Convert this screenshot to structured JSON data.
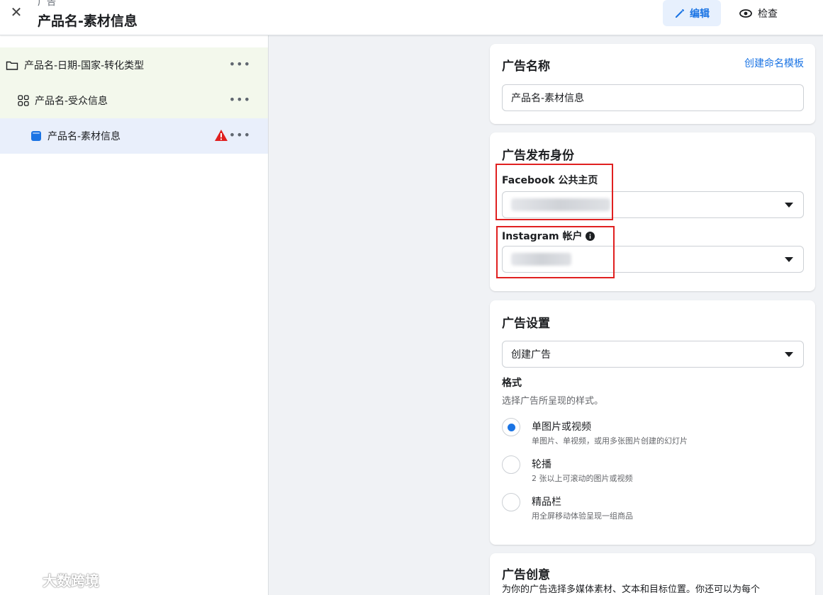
{
  "header": {
    "kicker": "广告",
    "title": "产品名-素材信息",
    "edit_label": "编辑",
    "review_label": "检查"
  },
  "tree": {
    "items": [
      {
        "label": "产品名-日期-国家-转化类型",
        "icon": "folder-icon"
      },
      {
        "label": "产品名-受众信息",
        "icon": "grid-icon"
      },
      {
        "label": "产品名-素材信息",
        "icon": "ad-icon",
        "warning": true
      }
    ],
    "more_glyph": "•••"
  },
  "ad_name": {
    "title": "广告名称",
    "template_link": "创建命名模板",
    "value": "产品名-素材信息"
  },
  "identity": {
    "title": "广告发布身份",
    "facebook_label": "Facebook 公共主页",
    "instagram_label": "Instagram 帐户"
  },
  "ad_settings": {
    "title": "广告设置",
    "select_value": "创建广告",
    "format_label": "格式",
    "format_desc": "选择广告所呈现的样式。",
    "options": [
      {
        "title": "单图片或视频",
        "desc": "单图片、单视频，或用多张图片创建的幻灯片",
        "selected": true
      },
      {
        "title": "轮播",
        "desc": "2 张以上可滚动的图片或视频",
        "selected": false
      },
      {
        "title": "精品栏",
        "desc": "用全屏移动体验呈现一组商品",
        "selected": false
      }
    ]
  },
  "creative": {
    "title": "广告创意",
    "desc": "为你的广告选择多媒体素材、文本和目标位置。你还可以为每个"
  },
  "watermark": "大数跨境",
  "colors": {
    "accent": "#1b74e4",
    "warning": "#e02020",
    "tree_highlight": "#e9effb"
  }
}
